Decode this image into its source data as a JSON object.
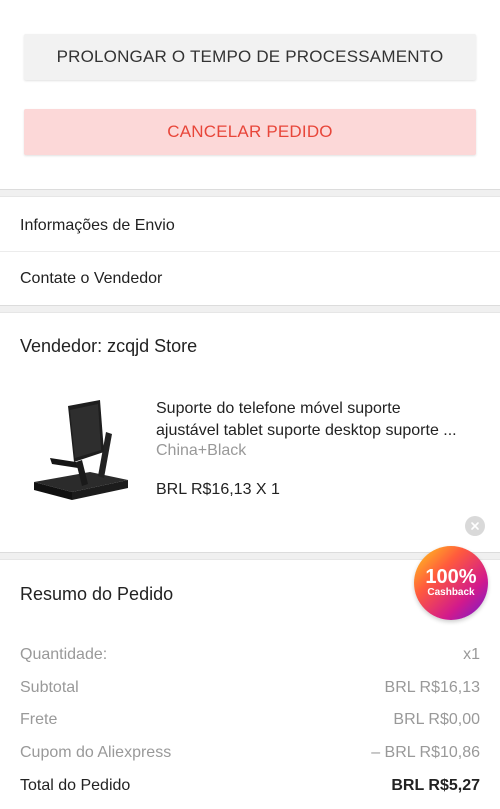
{
  "actions": {
    "extend_label": "PROLONGAR O TEMPO DE PROCESSAMENTO",
    "cancel_label": "CANCELAR PEDIDO"
  },
  "links": {
    "shipping": "Informações de Envio",
    "contact": "Contate o Vendedor"
  },
  "seller": {
    "label": "Vendedor: zcqjd Store"
  },
  "product": {
    "title_line1": "Suporte do telefone móvel suporte",
    "title_line2": "ajustável tablet suporte desktop suporte ...",
    "variant": "China+Black",
    "price": "BRL R$16,13 X 1"
  },
  "promo": {
    "percent": "100%",
    "label": "Cashback"
  },
  "summary": {
    "title": "Resumo do Pedido",
    "rows": [
      {
        "label": "Quantidade:",
        "value": "x1"
      },
      {
        "label": "Subtotal",
        "value": "BRL R$16,13"
      },
      {
        "label": "Frete",
        "value": "BRL R$0,00"
      },
      {
        "label": "Cupom do Aliexpress",
        "value": "– BRL R$10,86"
      }
    ],
    "total": {
      "label": "Total do Pedido",
      "value": "BRL R$5,27"
    }
  },
  "colors": {
    "cancel_text": "#e8463a",
    "cancel_bg": "#fcd8d8",
    "muted_text": "#999999"
  }
}
